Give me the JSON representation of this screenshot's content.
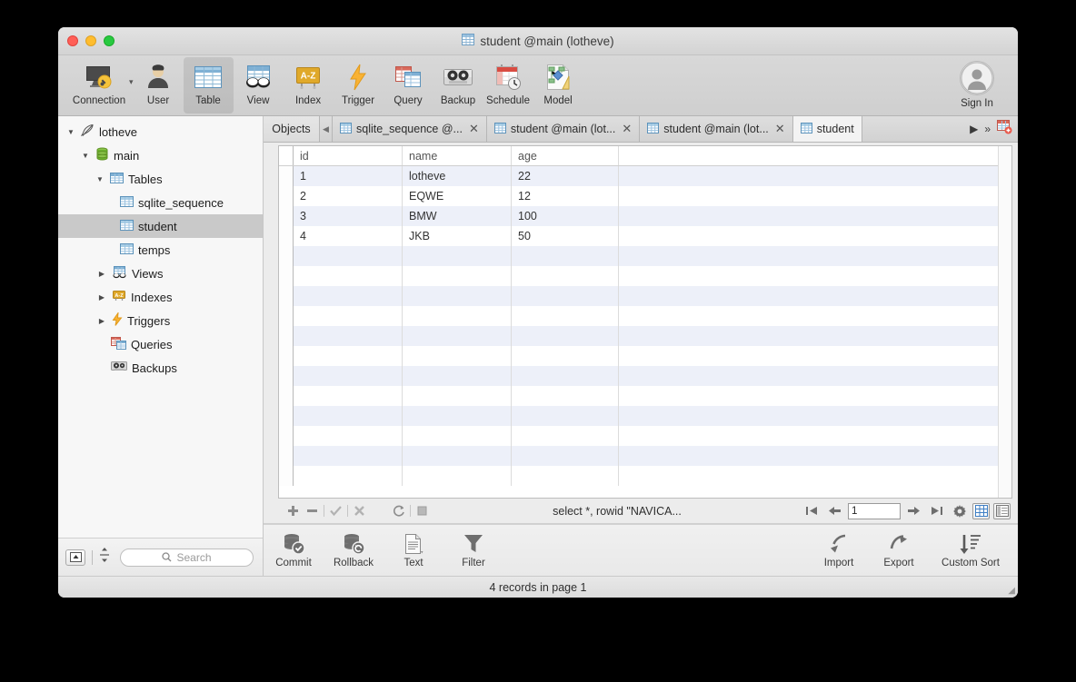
{
  "window": {
    "title": "student @main (lotheve)",
    "title_icon": "table-icon",
    "controls": {
      "close": "close",
      "minimize": "minimize",
      "zoom": "zoom"
    }
  },
  "toolbar": {
    "items": [
      {
        "label": "Connection",
        "icon": "connection-icon",
        "selected": false,
        "has_caret": true
      },
      {
        "label": "User",
        "icon": "user-icon",
        "selected": false,
        "has_caret": false
      },
      {
        "label": "Table",
        "icon": "table-icon",
        "selected": true,
        "has_caret": false
      },
      {
        "label": "View",
        "icon": "view-icon",
        "selected": false,
        "has_caret": false
      },
      {
        "label": "Index",
        "icon": "index-icon",
        "selected": false,
        "has_caret": false
      },
      {
        "label": "Trigger",
        "icon": "trigger-icon",
        "selected": false,
        "has_caret": false
      },
      {
        "label": "Query",
        "icon": "query-icon",
        "selected": false,
        "has_caret": false
      },
      {
        "label": "Backup",
        "icon": "backup-icon",
        "selected": false,
        "has_caret": false
      },
      {
        "label": "Schedule",
        "icon": "schedule-icon",
        "selected": false,
        "has_caret": false
      },
      {
        "label": "Model",
        "icon": "model-icon",
        "selected": false,
        "has_caret": false
      }
    ],
    "sign_in": {
      "label": "Sign In",
      "icon": "avatar-icon"
    }
  },
  "sidebar": {
    "tree": [
      {
        "label": "lotheve",
        "icon": "feather-icon",
        "indent": 0,
        "twisty": "down",
        "selected": false
      },
      {
        "label": "main",
        "icon": "database-icon",
        "indent": 1,
        "twisty": "down",
        "selected": false
      },
      {
        "label": "Tables",
        "icon": "tables-icon",
        "indent": 2,
        "twisty": "down",
        "selected": false
      },
      {
        "label": "sqlite_sequence",
        "icon": "table-icon",
        "indent": 3,
        "twisty": "none",
        "selected": false
      },
      {
        "label": "student",
        "icon": "table-icon",
        "indent": 3,
        "twisty": "none",
        "selected": true
      },
      {
        "label": "temps",
        "icon": "table-icon",
        "indent": 3,
        "twisty": "none",
        "selected": false
      },
      {
        "label": "Views",
        "icon": "views-icon",
        "indent": 2,
        "twisty": "right",
        "selected": false
      },
      {
        "label": "Indexes",
        "icon": "index-icon",
        "indent": 2,
        "twisty": "right",
        "selected": false
      },
      {
        "label": "Triggers",
        "icon": "trigger-icon",
        "indent": 2,
        "twisty": "right",
        "selected": false
      },
      {
        "label": "Queries",
        "icon": "query-icon",
        "indent": 2,
        "twisty": "none",
        "selected": false
      },
      {
        "label": "Backups",
        "icon": "backup-icon",
        "indent": 2,
        "twisty": "none",
        "selected": false
      }
    ],
    "bottom": {
      "collapse_icon": "collapse-panel-icon",
      "resize_icon": "resize-handle-icon",
      "search_placeholder": "Search",
      "search_value": ""
    }
  },
  "tabs": {
    "objects_label": "Objects",
    "scroll_left_icon": "chevron-left-icon",
    "items": [
      {
        "label": "sqlite_sequence @...",
        "icon": "table-icon",
        "active": false,
        "closable": true
      },
      {
        "label": "student @main (lot...",
        "icon": "table-icon",
        "active": false,
        "closable": true
      },
      {
        "label": "student @main (lot...",
        "icon": "table-icon",
        "active": false,
        "closable": true
      },
      {
        "label": "student",
        "icon": "table-icon",
        "active": true,
        "closable": false
      }
    ],
    "scroll_right_icon": "chevron-right-icon",
    "overflow_icon": "double-chevron-icon",
    "new_tab_icon": "new-tab-icon"
  },
  "grid": {
    "columns": [
      "id",
      "name",
      "age"
    ],
    "rows": [
      {
        "id": "1",
        "name": "lotheve",
        "age": "22"
      },
      {
        "id": "2",
        "name": "EQWE",
        "age": "12"
      },
      {
        "id": "3",
        "name": "BMW",
        "age": "100"
      },
      {
        "id": "4",
        "name": "JKB",
        "age": "50"
      }
    ],
    "empty_row_count": 12
  },
  "navbar": {
    "add_icon": "plus-icon",
    "remove_icon": "minus-icon",
    "apply_icon": "check-icon",
    "cancel_icon": "cross-icon",
    "refresh_icon": "refresh-icon",
    "stop_icon": "stop-icon",
    "sql_text": "select *, rowid \"NAVICA...",
    "first_page_icon": "first-page-icon",
    "prev_page_icon": "prev-page-icon",
    "page_value": "1",
    "next_page_icon": "next-page-icon",
    "last_page_icon": "last-page-icon",
    "settings_icon": "gear-icon",
    "grid_view_icon": "grid-view-icon",
    "form_view_icon": "form-view-icon"
  },
  "bottom_toolbar": {
    "left": [
      {
        "label": "Commit",
        "icon": "commit-icon"
      },
      {
        "label": "Rollback",
        "icon": "rollback-icon"
      },
      {
        "label": "Text",
        "icon": "text-icon"
      },
      {
        "label": "Filter",
        "icon": "filter-icon"
      }
    ],
    "right": [
      {
        "label": "Import",
        "icon": "import-icon"
      },
      {
        "label": "Export",
        "icon": "export-icon"
      },
      {
        "label": "Custom Sort",
        "icon": "custom-sort-icon"
      }
    ]
  },
  "statusbar": {
    "text": "4 records in page 1"
  },
  "colors": {
    "accent_blue": "#4A90D9",
    "row_stripe": "#EDF0F9",
    "selection_gray": "#C9C9C9",
    "window_chrome": "#ECECEC"
  }
}
